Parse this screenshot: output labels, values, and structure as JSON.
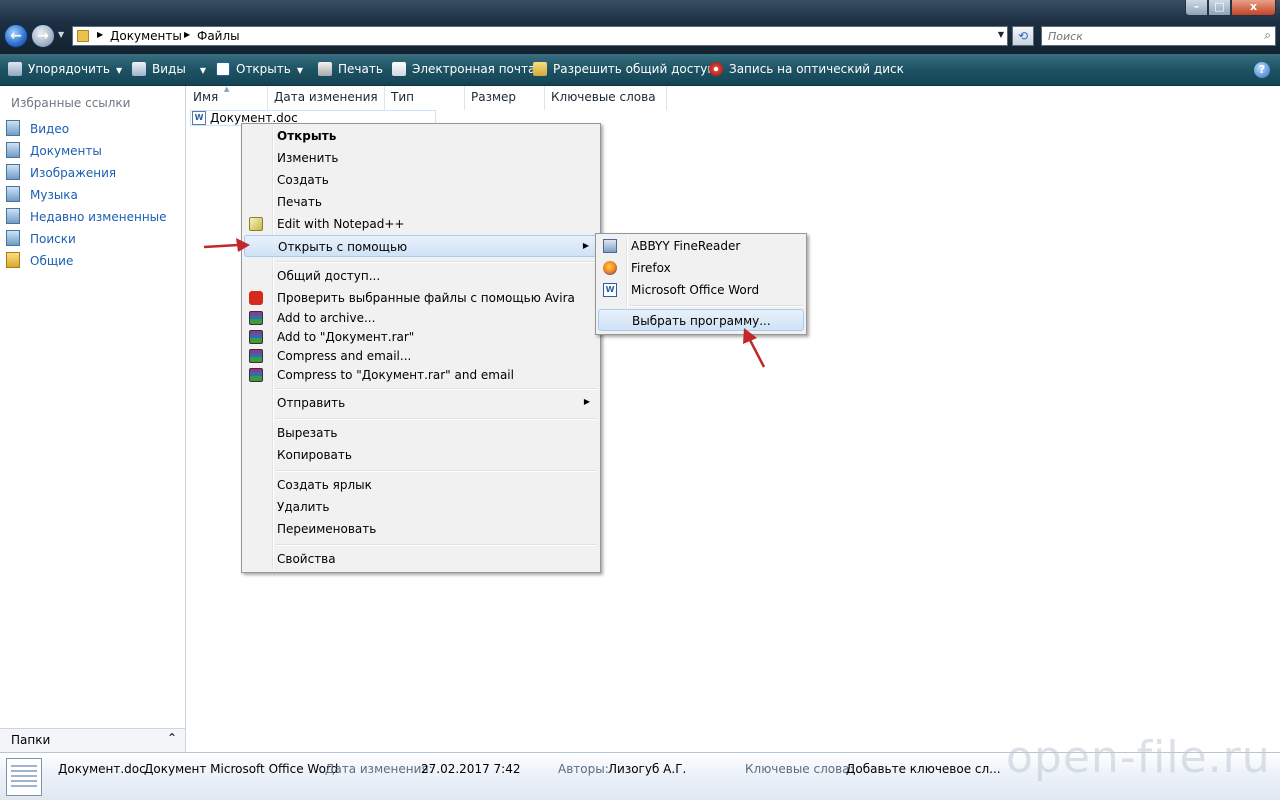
{
  "window": {
    "controls": {
      "min": "–",
      "max": "□",
      "close": "x"
    }
  },
  "address": {
    "crumbs": [
      "Документы",
      "Файлы"
    ],
    "search_placeholder": "Поиск"
  },
  "toolbar": {
    "organize": "Упорядочить",
    "views": "Виды",
    "open": "Открыть",
    "print": "Печать",
    "email": "Электронная почта",
    "share": "Разрешить общий доступ",
    "burn": "Запись на оптический диск",
    "help": "?"
  },
  "nav": {
    "title": "Избранные ссылки",
    "items": [
      {
        "label": "Видео",
        "icon": "video-library-icon"
      },
      {
        "label": "Документы",
        "icon": "documents-library-icon"
      },
      {
        "label": "Изображения",
        "icon": "pictures-library-icon"
      },
      {
        "label": "Музыка",
        "icon": "music-library-icon"
      },
      {
        "label": "Недавно измененные",
        "icon": "recent-icon"
      },
      {
        "label": "Поиски",
        "icon": "searches-icon"
      },
      {
        "label": "Общие",
        "icon": "public-folder-icon"
      }
    ],
    "folders_label": "Папки"
  },
  "columns": [
    "Имя",
    "Дата изменения",
    "Тип",
    "Размер",
    "Ключевые слова"
  ],
  "file": {
    "name": "Документ.doc",
    "icon_text": "W"
  },
  "context_menu": {
    "items": [
      "Открыть",
      "Изменить",
      "Создать",
      "Печать",
      "Edit with Notepad++",
      "Открыть с помощью",
      "Общий доступ...",
      "Проверить выбранные файлы с помощью Avira",
      "Add to archive...",
      "Add to \"Документ.rar\"",
      "Compress and email...",
      "Compress to \"Документ.rar\" and email",
      "Отправить",
      "Вырезать",
      "Копировать",
      "Создать ярлык",
      "Удалить",
      "Переименовать",
      "Свойства"
    ]
  },
  "submenu": {
    "items": [
      "ABBYY FineReader",
      "Firefox",
      "Microsoft Office Word",
      "Выбрать программу..."
    ]
  },
  "details": {
    "filename": "Документ.doc",
    "type": "Документ Microsoft Office Word",
    "modified_label": "Дата изменения:",
    "modified_value": "27.02.2017 7:42",
    "authors_label": "Авторы:",
    "authors_value": "Лизогуб А.Г.",
    "keywords_label": "Ключевые слова:",
    "keywords_value": "Добавьте ключевое сл..."
  },
  "watermark": "open-file.ru",
  "colors": {
    "toolbar": "#1f5566",
    "link": "#1b5fb3",
    "menu_highlight": "#cfe2f6",
    "annotation_arrow": "#c0282a"
  }
}
